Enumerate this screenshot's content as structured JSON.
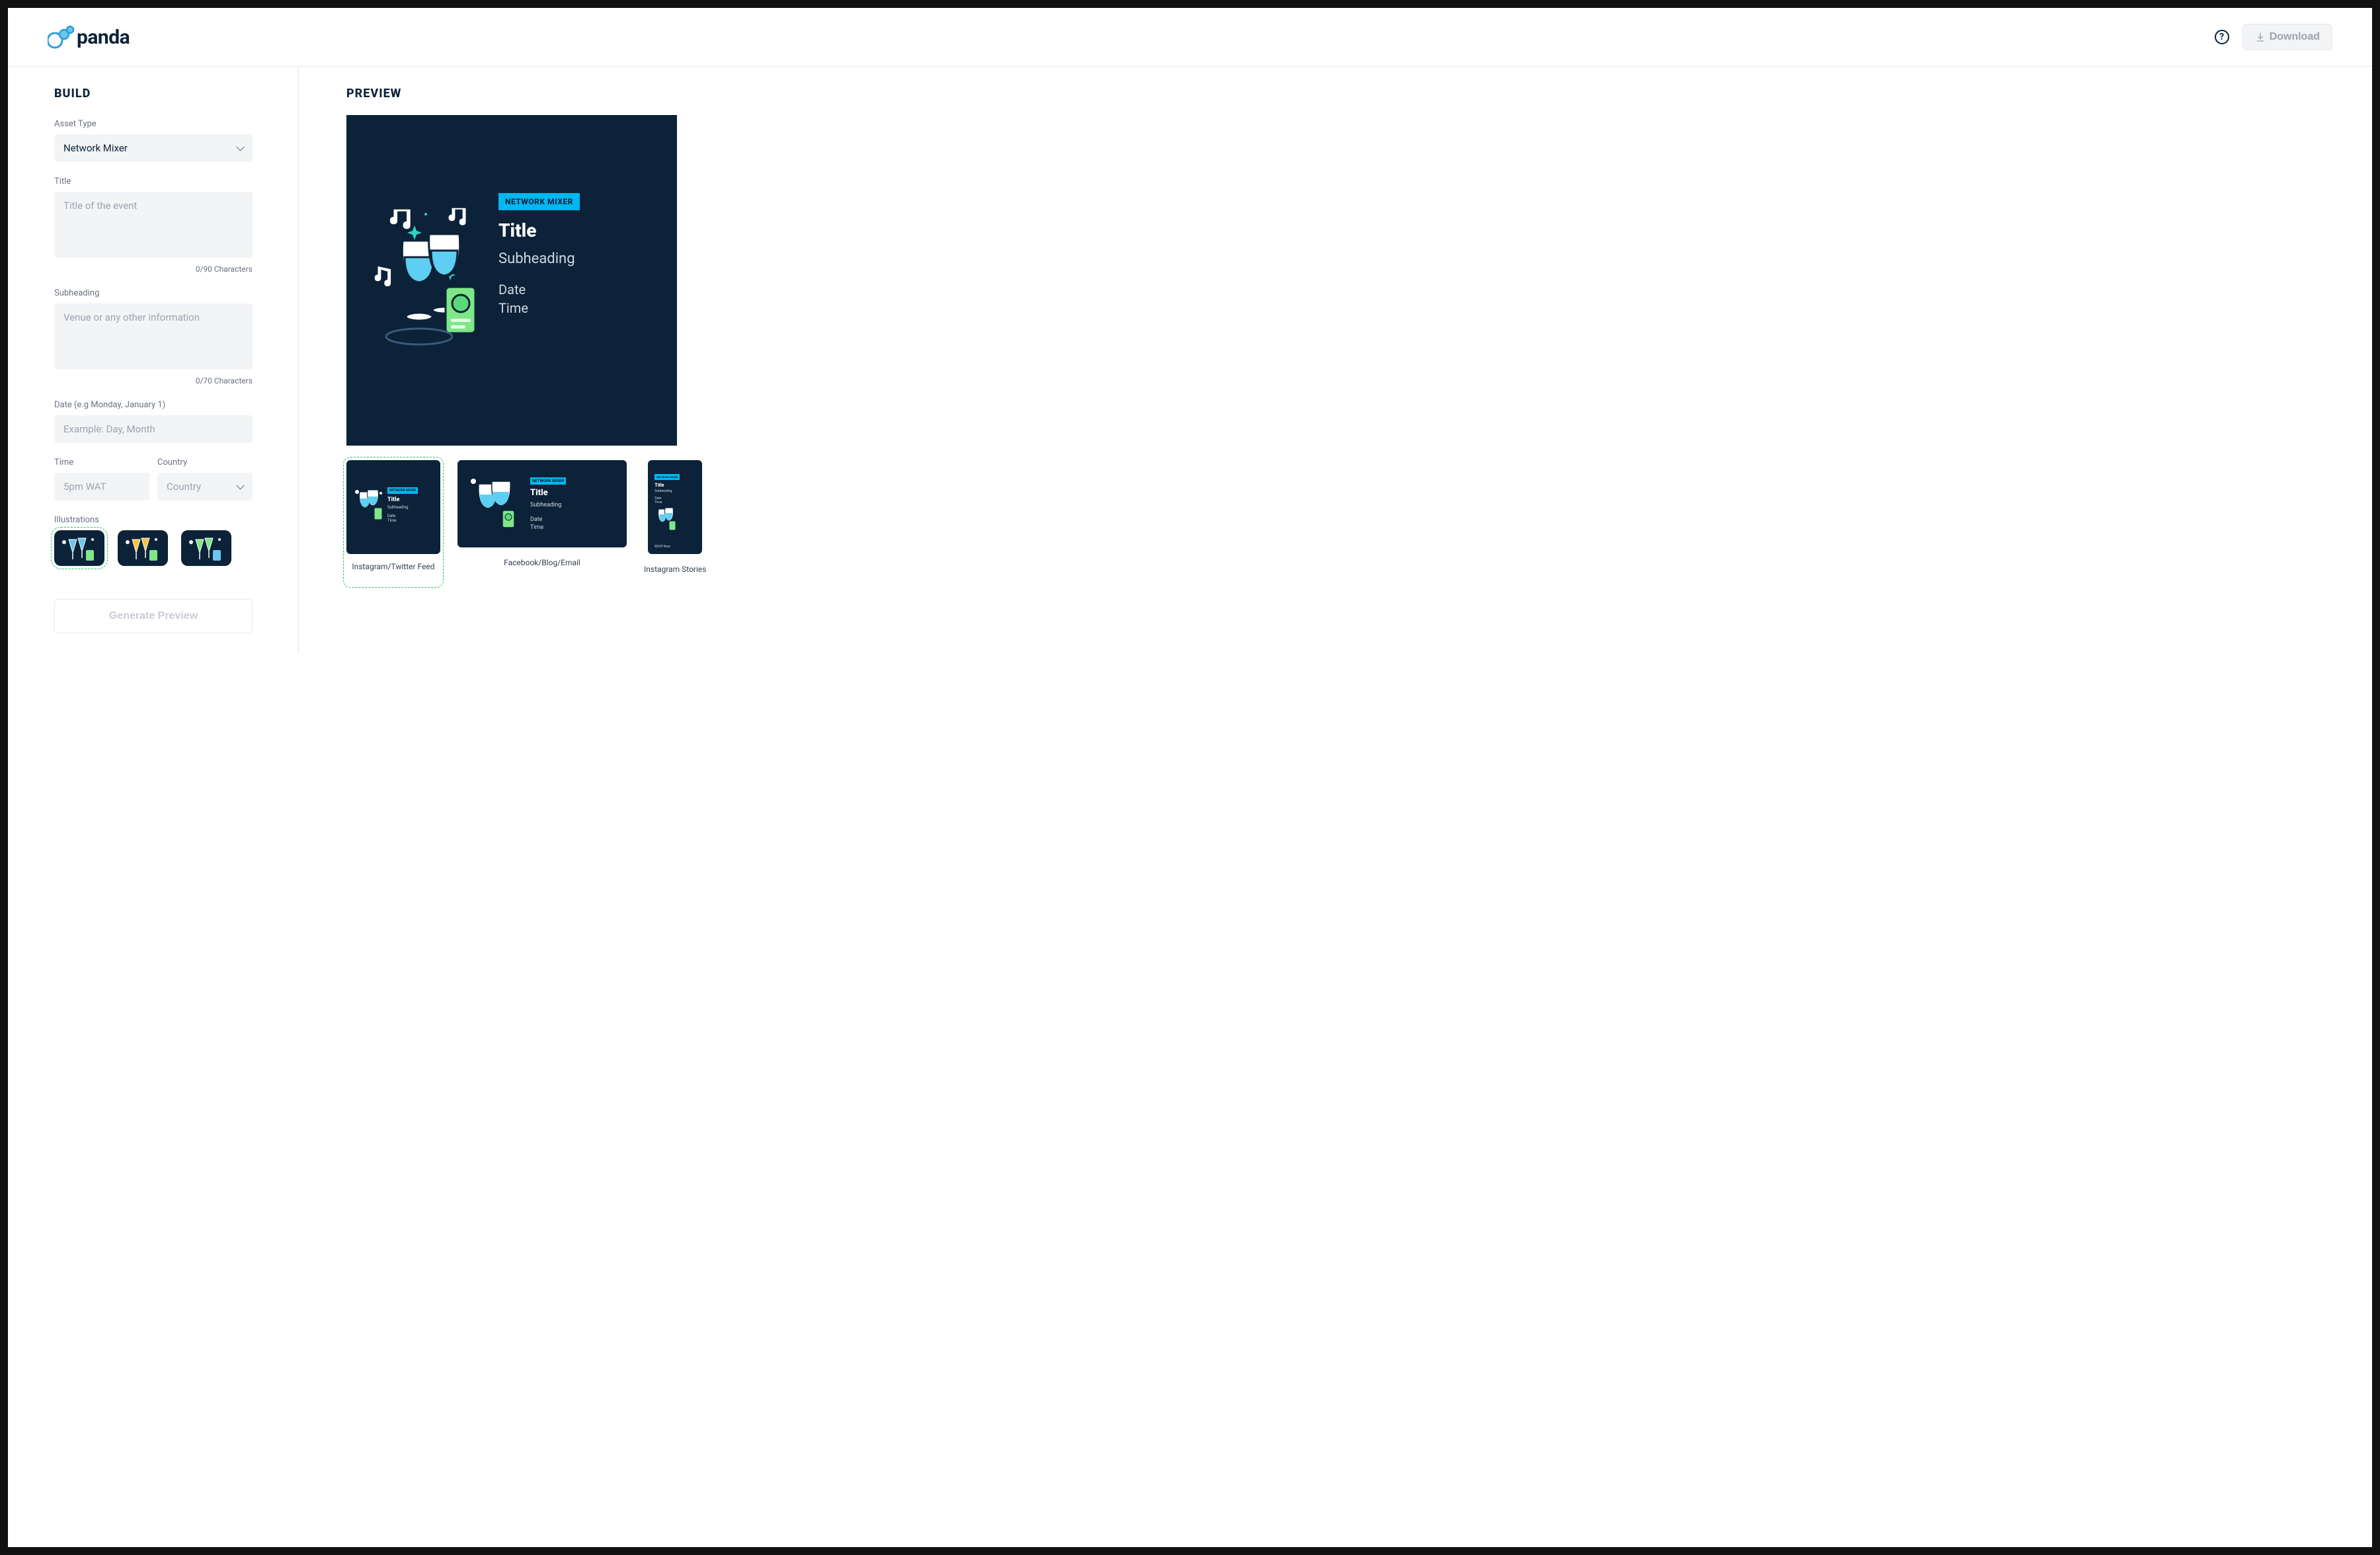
{
  "header": {
    "brand": "panda",
    "download_label": "Download"
  },
  "build": {
    "title": "BUILD",
    "asset_type": {
      "label": "Asset Type",
      "value": "Network Mixer"
    },
    "title_field": {
      "label": "Title",
      "placeholder": "Title of the event",
      "counter": "0/90 Characters"
    },
    "subheading_field": {
      "label": "Subheading",
      "placeholder": "Venue or any other information",
      "counter": "0/70 Characters"
    },
    "date_field": {
      "label": "Date (e.g Monday, January 1)",
      "placeholder": "Example: Day, Month"
    },
    "time_field": {
      "label": "Time",
      "placeholder": "5pm WAT"
    },
    "country_field": {
      "label": "Country",
      "placeholder": "Country"
    },
    "illustrations_label": "Illustrations",
    "generate_label": "Generate Preview"
  },
  "preview": {
    "title": "PREVIEW",
    "badge": "NETWORK MIXER",
    "card_title": "Title",
    "card_sub": "Subheading",
    "card_date": "Date",
    "card_time": "Time",
    "footer_text": "RSVP Now",
    "formats": [
      {
        "label": "Instagram/Twitter Feed"
      },
      {
        "label": "Facebook/Blog/Email"
      },
      {
        "label": "Instagram Stories"
      }
    ]
  },
  "colors": {
    "accent": "#00b8f0",
    "dark": "#0b2239",
    "green": "#7ee787"
  }
}
